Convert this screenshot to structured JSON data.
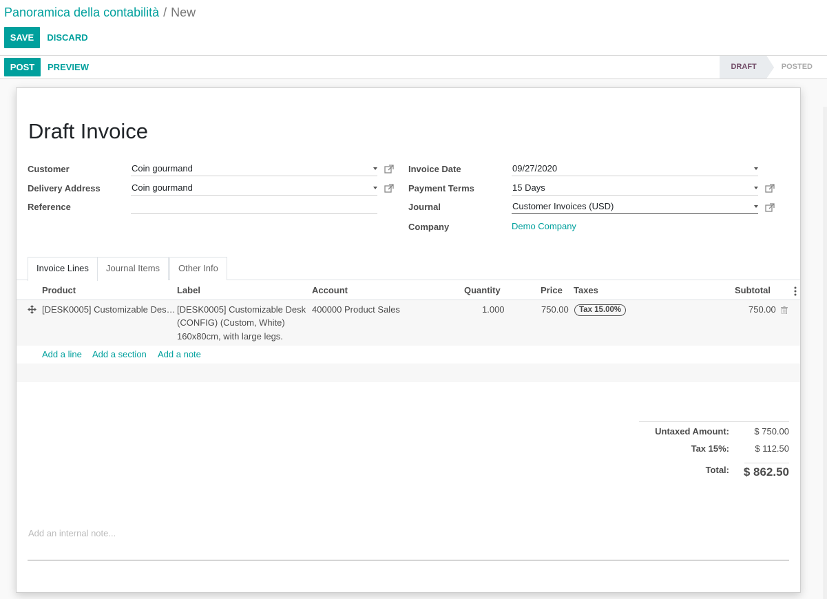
{
  "breadcrumb": {
    "parent": "Panoramica della contabilità",
    "separator": "/",
    "current": "New"
  },
  "buttons": {
    "save": "SAVE",
    "discard": "DISCARD",
    "post": "POST",
    "preview": "PREVIEW"
  },
  "status": {
    "draft": "DRAFT",
    "posted": "POSTED"
  },
  "invoice": {
    "title": "Draft Invoice",
    "customer_label": "Customer",
    "customer": "Coin gourmand",
    "delivery_label": "Delivery Address",
    "delivery": "Coin gourmand",
    "reference_label": "Reference",
    "reference": "",
    "date_label": "Invoice Date",
    "date": "09/27/2020",
    "terms_label": "Payment Terms",
    "terms": "15 Days",
    "journal_label": "Journal",
    "journal": "Customer Invoices (USD)",
    "company_label": "Company",
    "company": "Demo Company"
  },
  "tabs": [
    "Invoice Lines",
    "Journal Items",
    "Other Info"
  ],
  "table": {
    "headers": [
      "Product",
      "Label",
      "Account",
      "Quantity",
      "Price",
      "Taxes",
      "Subtotal"
    ],
    "rows": [
      {
        "product": "[DESK0005] Customizable Des…",
        "label_line1": "[DESK0005] Customizable Desk",
        "label_line2": "(CONFIG) (Custom, White)",
        "label_line3": "160x80cm, with large legs.",
        "account": "400000 Product Sales",
        "quantity": "1.000",
        "price": "750.00",
        "tax": "Tax 15.00%",
        "subtotal": "750.00"
      }
    ],
    "add_line": "Add a line",
    "add_section": "Add a section",
    "add_note": "Add a note"
  },
  "totals": {
    "untaxed_label": "Untaxed Amount:",
    "untaxed": "$ 750.00",
    "tax_label": "Tax 15%:",
    "tax": "$ 112.50",
    "total_label": "Total:",
    "total": "$ 862.50"
  },
  "note_placeholder": "Add an internal note...",
  "colors": {
    "primary": "#00a09d",
    "status_active": "#714b67"
  },
  "icons": [
    "external-link-icon",
    "caret-down-icon",
    "drag-handle-icon",
    "trash-icon",
    "kebab-menu-icon"
  ]
}
